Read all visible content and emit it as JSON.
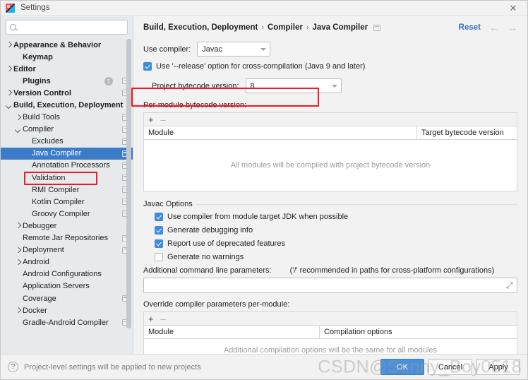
{
  "window": {
    "title": "Settings",
    "close_label": "✕",
    "app_icon": "intellij-idea-icon"
  },
  "sidebar": {
    "search": {
      "value": "",
      "placeholder": ""
    },
    "items": [
      {
        "label": "Appearance & Behavior",
        "indent": 0,
        "arrow": "right",
        "bold": true,
        "cfg": false,
        "badge": null,
        "selected": false
      },
      {
        "label": "Keymap",
        "indent": 1,
        "arrow": "none",
        "bold": true,
        "cfg": false,
        "badge": null,
        "selected": false
      },
      {
        "label": "Editor",
        "indent": 0,
        "arrow": "right",
        "bold": true,
        "cfg": false,
        "badge": null,
        "selected": false
      },
      {
        "label": "Plugins",
        "indent": 1,
        "arrow": "none",
        "bold": true,
        "cfg": true,
        "badge": "1",
        "selected": false
      },
      {
        "label": "Version Control",
        "indent": 0,
        "arrow": "right",
        "bold": true,
        "cfg": true,
        "badge": null,
        "selected": false
      },
      {
        "label": "Build, Execution, Deployment",
        "indent": 0,
        "arrow": "down",
        "bold": true,
        "cfg": false,
        "badge": null,
        "selected": false
      },
      {
        "label": "Build Tools",
        "indent": 1,
        "arrow": "right",
        "bold": false,
        "cfg": true,
        "badge": null,
        "selected": false
      },
      {
        "label": "Compiler",
        "indent": 1,
        "arrow": "down",
        "bold": false,
        "cfg": true,
        "badge": null,
        "selected": false
      },
      {
        "label": "Excludes",
        "indent": 2,
        "arrow": "none",
        "bold": false,
        "cfg": true,
        "badge": null,
        "selected": false
      },
      {
        "label": "Java Compiler",
        "indent": 2,
        "arrow": "none",
        "bold": false,
        "cfg": true,
        "badge": null,
        "selected": true
      },
      {
        "label": "Annotation Processors",
        "indent": 2,
        "arrow": "none",
        "bold": false,
        "cfg": true,
        "badge": null,
        "selected": false
      },
      {
        "label": "Validation",
        "indent": 2,
        "arrow": "none",
        "bold": false,
        "cfg": true,
        "badge": null,
        "selected": false
      },
      {
        "label": "RMI Compiler",
        "indent": 2,
        "arrow": "none",
        "bold": false,
        "cfg": true,
        "badge": null,
        "selected": false
      },
      {
        "label": "Kotlin Compiler",
        "indent": 2,
        "arrow": "none",
        "bold": false,
        "cfg": true,
        "badge": null,
        "selected": false
      },
      {
        "label": "Groovy Compiler",
        "indent": 2,
        "arrow": "none",
        "bold": false,
        "cfg": true,
        "badge": null,
        "selected": false
      },
      {
        "label": "Debugger",
        "indent": 1,
        "arrow": "right",
        "bold": false,
        "cfg": false,
        "badge": null,
        "selected": false
      },
      {
        "label": "Remote Jar Repositories",
        "indent": 1,
        "arrow": "none",
        "bold": false,
        "cfg": true,
        "badge": null,
        "selected": false
      },
      {
        "label": "Deployment",
        "indent": 1,
        "arrow": "right",
        "bold": false,
        "cfg": true,
        "badge": null,
        "selected": false
      },
      {
        "label": "Android",
        "indent": 1,
        "arrow": "right",
        "bold": false,
        "cfg": false,
        "badge": null,
        "selected": false
      },
      {
        "label": "Android Configurations",
        "indent": 1,
        "arrow": "none",
        "bold": false,
        "cfg": false,
        "badge": null,
        "selected": false
      },
      {
        "label": "Application Servers",
        "indent": 1,
        "arrow": "none",
        "bold": false,
        "cfg": false,
        "badge": null,
        "selected": false
      },
      {
        "label": "Coverage",
        "indent": 1,
        "arrow": "none",
        "bold": false,
        "cfg": true,
        "badge": null,
        "selected": false
      },
      {
        "label": "Docker",
        "indent": 1,
        "arrow": "right",
        "bold": false,
        "cfg": false,
        "badge": null,
        "selected": false
      },
      {
        "label": "Gradle-Android Compiler",
        "indent": 1,
        "arrow": "none",
        "bold": false,
        "cfg": true,
        "badge": null,
        "selected": false
      }
    ]
  },
  "header": {
    "breadcrumbs": [
      "Build, Execution, Deployment",
      "Compiler",
      "Java Compiler"
    ],
    "separator": "›",
    "reset_label": "Reset",
    "back_arrow": "←",
    "forward_arrow": "→"
  },
  "main": {
    "use_compiler_label": "Use compiler:",
    "use_compiler_value": "Javac",
    "release_option_label": "Use '--release' option for cross-compilation (Java 9 and later)",
    "release_option_checked": true,
    "project_bytecode_label": "Project bytecode version:",
    "project_bytecode_value": "8",
    "per_module_label": "Per-module bytecode version:",
    "per_module_table": {
      "add_label": "+",
      "remove_label": "–",
      "columns": [
        "Module",
        "Target bytecode version"
      ],
      "rows": [],
      "empty_text": "All modules will be compiled with project bytecode version"
    },
    "javac_options": {
      "group_title": "Javac Options",
      "checkboxes": [
        {
          "label": "Use compiler from module target JDK when possible",
          "checked": true
        },
        {
          "label": "Generate debugging info",
          "checked": true
        },
        {
          "label": "Report use of deprecated features",
          "checked": true
        },
        {
          "label": "Generate no warnings",
          "checked": false
        }
      ],
      "additional_params_label": "Additional command line parameters:",
      "additional_params_hint": "('/' recommended in paths for cross-platform configurations)",
      "additional_params_value": "",
      "expand_icon": "expand-icon"
    },
    "override_label": "Override compiler parameters per-module:",
    "override_table": {
      "add_label": "+",
      "remove_label": "–",
      "columns": [
        "Module",
        "Compilation options"
      ],
      "rows": [],
      "empty_text": "Additional compilation options will be the same for all modules"
    }
  },
  "footer": {
    "help_label": "?",
    "note": "Project-level settings will be applied to new projects",
    "ok_label": "OK",
    "cancel_label": "Cancel",
    "apply_label": "Apply",
    "watermark": "CSDN@Sunny_Boy0518"
  },
  "colors": {
    "accent": "#3a7cc7",
    "highlight_box": "#ee1c25",
    "link": "#3a73b8",
    "sidebar_bg": "#e6eaed"
  }
}
